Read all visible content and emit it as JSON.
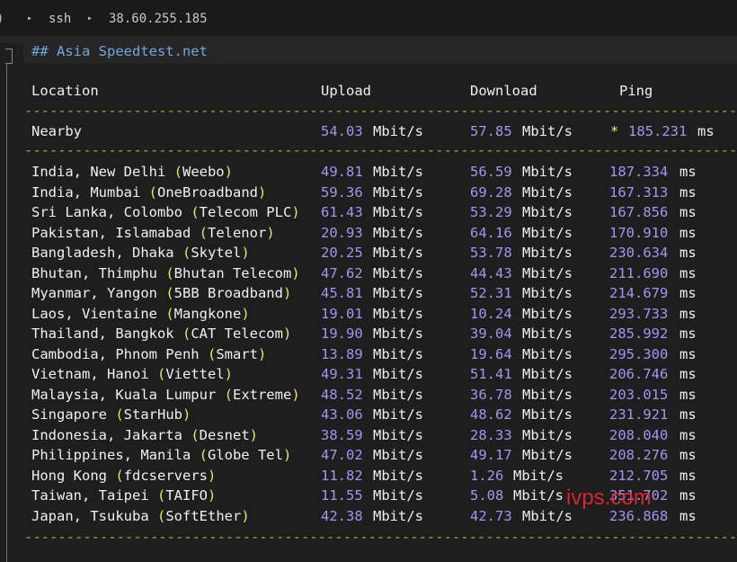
{
  "topbar": {
    "host_label": "ssh",
    "address": "38.60.255.185"
  },
  "heading": "## Asia Speedtest.net",
  "columns": {
    "location": "Location",
    "upload": "Upload",
    "download": "Download",
    "ping": "Ping"
  },
  "nearby": {
    "location": "Nearby",
    "upload": "54.03",
    "upload_unit": "Mbit/s",
    "download": "57.85",
    "download_unit": "Mbit/s",
    "star": "*",
    "ping": "185.231",
    "ping_unit": "ms"
  },
  "rows": [
    {
      "city": "India, New Delhi",
      "isp": "Weebo",
      "upload": "49.81",
      "download": "56.59",
      "ping": "187.334"
    },
    {
      "city": "India, Mumbai",
      "isp": "OneBroadband",
      "upload": "59.36",
      "download": "69.28",
      "ping": "167.313"
    },
    {
      "city": "Sri Lanka, Colombo",
      "isp": "Telecom PLC",
      "upload": "61.43",
      "download": "53.29",
      "ping": "167.856"
    },
    {
      "city": "Pakistan, Islamabad",
      "isp": "Telenor",
      "upload": "20.93",
      "download": "64.16",
      "ping": "170.910"
    },
    {
      "city": "Bangladesh, Dhaka",
      "isp": "Skytel",
      "upload": "20.25",
      "download": "53.78",
      "ping": "230.634"
    },
    {
      "city": "Bhutan, Thimphu",
      "isp": "Bhutan Telecom",
      "upload": "47.62",
      "download": "44.43",
      "ping": "211.690"
    },
    {
      "city": "Myanmar, Yangon",
      "isp": "5BB Broadband",
      "upload": "45.81",
      "download": "52.31",
      "ping": "214.679"
    },
    {
      "city": "Laos, Vientaine",
      "isp": "Mangkone",
      "upload": "19.01",
      "download": "10.24",
      "ping": "293.733"
    },
    {
      "city": "Thailand, Bangkok",
      "isp": "CAT Telecom",
      "upload": "19.90",
      "download": "39.04",
      "ping": "285.992"
    },
    {
      "city": "Cambodia, Phnom Penh",
      "isp": "Smart",
      "upload": "13.89",
      "download": "19.64",
      "ping": "295.300"
    },
    {
      "city": "Vietnam, Hanoi",
      "isp": "Viettel",
      "upload": "49.31",
      "download": "51.41",
      "ping": "206.746"
    },
    {
      "city": "Malaysia, Kuala Lumpur",
      "isp": "Extreme",
      "upload": "48.52",
      "download": "36.78",
      "ping": "203.015"
    },
    {
      "city": "Singapore",
      "isp": "StarHub",
      "upload": "43.06",
      "download": "48.62",
      "ping": "231.921"
    },
    {
      "city": "Indonesia, Jakarta",
      "isp": "Desnet",
      "upload": "38.59",
      "download": "28.33",
      "ping": "208.040"
    },
    {
      "city": "Philippines, Manila",
      "isp": "Globe Tel",
      "upload": "47.02",
      "download": "49.17",
      "ping": "208.276"
    },
    {
      "city": "Hong Kong",
      "isp": "fdcservers",
      "upload": "11.82",
      "download": "1.26",
      "ping": "212.705"
    },
    {
      "city": "Taiwan, Taipei",
      "isp": "TAIFO",
      "upload": "11.55",
      "download": "5.08",
      "ping": "351.702"
    },
    {
      "city": "Japan, Tsukuba",
      "isp": "SoftEther",
      "upload": "42.38",
      "download": "42.73",
      "ping": "236.868"
    }
  ],
  "units": {
    "speed": "Mbit/s",
    "ping": "ms"
  },
  "watermark": "ivps.com",
  "colors": {
    "background": "#1e1e1e",
    "value": "#a992f0",
    "dash": "#8db83a",
    "heading": "#6fa8dc",
    "star": "#e9e566"
  }
}
